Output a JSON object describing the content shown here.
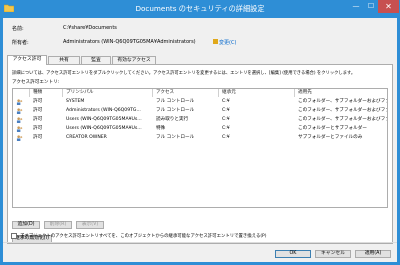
{
  "window": {
    "title": "Documents のセキュリティの詳細設定",
    "minimize": "—",
    "maximize": "☐",
    "close": "✕"
  },
  "header": {
    "name_label": "名前:",
    "name_value": "C:¥share¥Documents",
    "owner_label": "所有者:",
    "owner_value": "Administrators (WIN-Q6Q09TG05MA¥Administrators)",
    "owner_change_link": "変更(C)"
  },
  "tabs": [
    "アクセス許可",
    "共有",
    "監査",
    "有効なアクセス"
  ],
  "main": {
    "description": "詳細については、アクセス許可エントリをダブルクリックしてください。アクセス許可エントリを変更するには、エントリを選択し、[編集] (使用できる場合) をクリックします。",
    "entries_label": "アクセス許可エントリ:",
    "columns": [
      "種類",
      "プリンシパル",
      "アクセス",
      "継承元",
      "適用先"
    ],
    "rows": [
      [
        "許可",
        "SYSTEM",
        "フル コントロール",
        "C:¥",
        "このフォルダー、サブフォルダーおよびファイル"
      ],
      [
        "許可",
        "Administrators (WIN-Q6Q09TG...",
        "フル コントロール",
        "C:¥",
        "このフォルダー、サブフォルダーおよびファイル"
      ],
      [
        "許可",
        "Users (WIN-Q6Q09TG05MA¥Us...",
        "読み取りと実行",
        "C:¥",
        "このフォルダー、サブフォルダーおよびファイル"
      ],
      [
        "許可",
        "Users (WIN-Q6Q09TG05MA¥Us...",
        "特殊",
        "C:¥",
        "このフォルダーとサブフォルダー"
      ],
      [
        "許可",
        "CREATOR OWNER",
        "フル コントロール",
        "C:¥",
        "サブフォルダーとファイルのみ"
      ]
    ]
  },
  "actions": {
    "add": "追加(D)",
    "remove": "削除(R)",
    "view": "表示(V)",
    "disable_inheritance": "継承の無効化(I)",
    "replace_child_label": "子オブジェクトのアクセス許可エントリすべてを、このオブジェクトからの継承可能なアクセス許可エントリで置き換える(P)"
  },
  "footer": {
    "ok": "OK",
    "cancel": "キャンセル",
    "apply": "適用(A)"
  },
  "colors": {
    "title_bar": "#2e8ed6",
    "close_button": "#c75050",
    "link": "#0066cc"
  }
}
